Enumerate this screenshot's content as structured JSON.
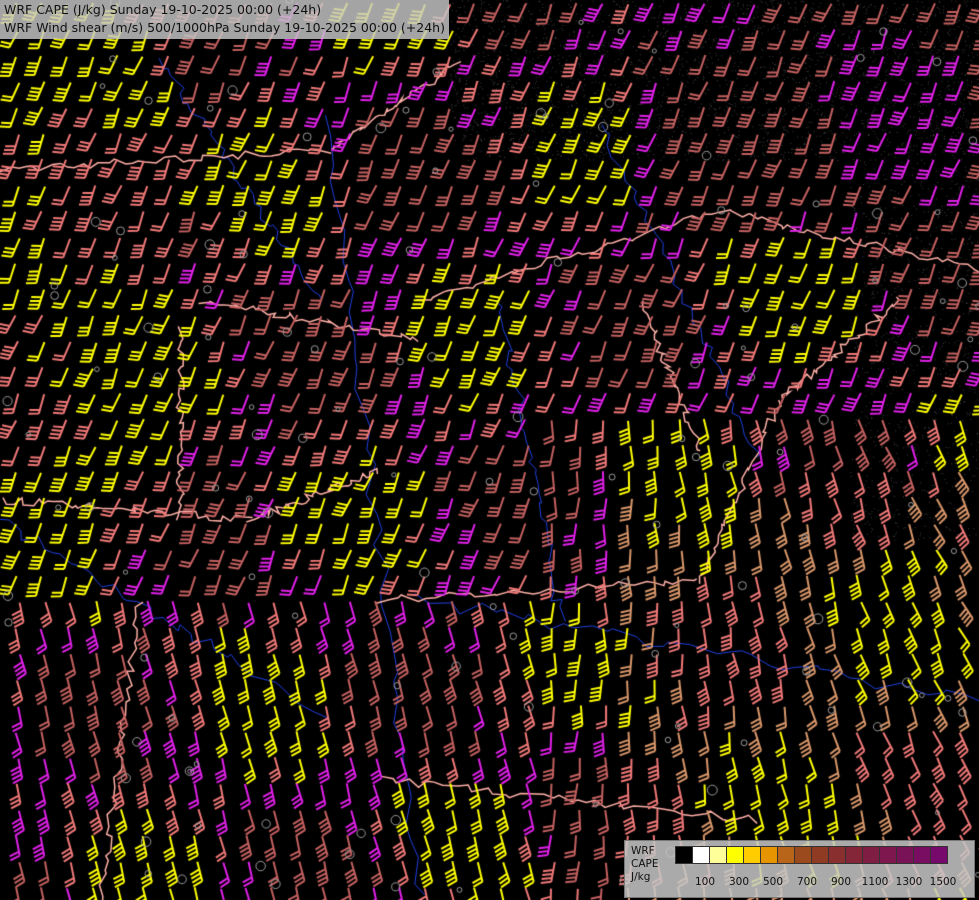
{
  "title": {
    "line1": "WRF CAPE (J/kg) Sunday 19-10-2025 00:00 (+24h)",
    "line2": "WRF Wind shear (m/s) 500/1000hPa Sunday 19-10-2025 00:00 (+24h)"
  },
  "legend": {
    "side_labels": [
      "WRF",
      "CAPE",
      "J/kg"
    ],
    "colors": [
      "#000000",
      "#ffffff",
      "#ffff99",
      "#ffff00",
      "#ffcc00",
      "#e69500",
      "#b8651a",
      "#9b4a1e",
      "#8f3a22",
      "#8a2f2f",
      "#852538",
      "#801d42",
      "#7d174d",
      "#7a1257",
      "#780d62",
      "#77096c"
    ],
    "tick_labels": [
      "100",
      "300",
      "500",
      "700",
      "900",
      "1100",
      "1300",
      "1500"
    ]
  },
  "barb_colors": {
    "pink": "#f07878",
    "yellow": "#ffff00",
    "magenta": "#e020e8",
    "tan": "#d8966a",
    "rose": "#c46060",
    "borders": "#ffb0a8",
    "rivers": "#2040e0"
  }
}
